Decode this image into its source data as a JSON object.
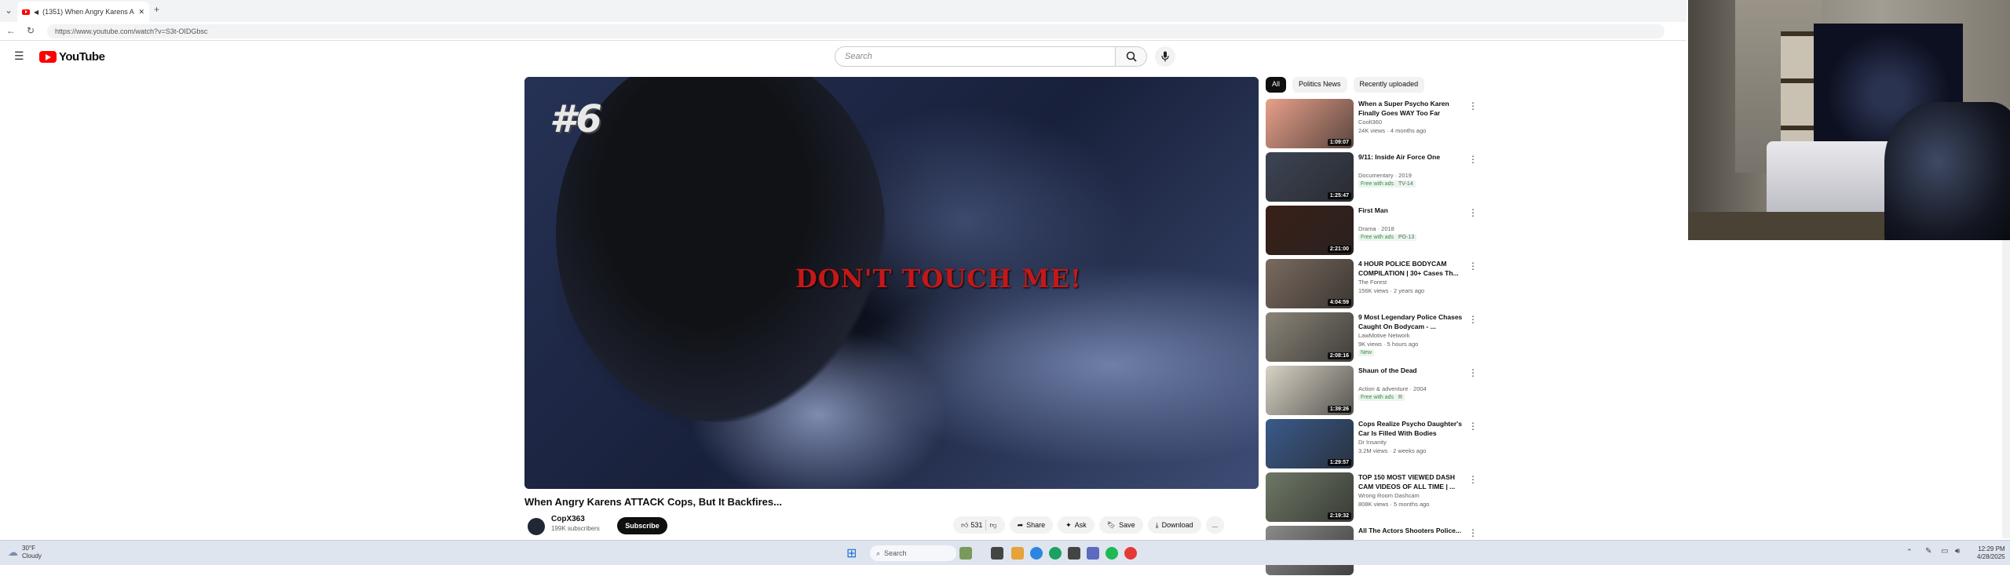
{
  "browser": {
    "tab_title": "(1351) When Angry Karens A",
    "new_tab": "+",
    "url": "https://www.youtube.com/watch?v=S3t-OIDGbsc"
  },
  "header": {
    "logo_text": "YouTube",
    "search_placeholder": "Search"
  },
  "video": {
    "rank_overlay": "#6",
    "caption_overlay": "DON'T TOUCH ME!",
    "title": "When Angry Karens ATTACK Cops, But It Backfires...",
    "channel": "CopX363",
    "subscribers": "199K subscribers",
    "subscribe_label": "Subscribe",
    "likes": "531",
    "share_label": "Share",
    "ask_label": "Ask",
    "save_label": "Save",
    "download_label": "Download",
    "more_label": "..."
  },
  "chips": [
    "All",
    "Politics News",
    "Recently uploaded"
  ],
  "recommendations": [
    {
      "title": "When a Super Psycho Karen Finally Goes WAY Too Far",
      "channel": "Coolt360",
      "meta": "24K views · 4 months ago",
      "duration": "1:09:07",
      "badge": "",
      "rating": "",
      "thumb": "#e8a08a"
    },
    {
      "title": "9/11: Inside Air Force One",
      "channel": "Documentary · 2019",
      "meta": "",
      "duration": "1:25:47",
      "badge": "Free with ads",
      "rating": "TV-14",
      "thumb": "#3c4454"
    },
    {
      "title": "First Man",
      "channel": "Drama · 2018",
      "meta": "",
      "duration": "2:21:00",
      "badge": "Free with ads",
      "rating": "PG-13",
      "thumb": "#3a2018"
    },
    {
      "title": "4 HOUR POLICE BODYCAM COMPILATION | 30+ Cases Th...",
      "channel": "The Forest",
      "meta": "156K views · 2 years ago",
      "duration": "4:04:59",
      "badge": "",
      "rating": "",
      "thumb": "#7a6a5e"
    },
    {
      "title": "9 Most Legendary Police Chases Caught On Bodycam - ...",
      "channel": "LawMotive Network",
      "meta": "9K views · 5 hours ago",
      "duration": "2:08:16",
      "badge": "New",
      "rating": "",
      "thumb": "#8a8478"
    },
    {
      "title": "Shaun of the Dead",
      "channel": "Action & adventure · 2004",
      "meta": "",
      "duration": "1:39:26",
      "badge": "Free with ads",
      "rating": "R",
      "thumb": "#d8d2c4"
    },
    {
      "title": "Cops Realize Psycho Daughter's Car Is Filled With Bodies",
      "channel": "Dr Insanity",
      "meta": "3.2M views · 2 weeks ago",
      "duration": "1:29:57",
      "badge": "",
      "rating": "",
      "thumb": "#3a5a8a"
    },
    {
      "title": "TOP 150 MOST VIEWED DASH CAM VIDEOS OF ALL TIME | ...",
      "channel": "Wrong Room Dashcam",
      "meta": "808K views · 5 months ago",
      "duration": "2:19:32",
      "badge": "",
      "rating": "",
      "thumb": "#6e7866"
    },
    {
      "title": "All The Actors Shooters Police...",
      "channel": "",
      "meta": "",
      "duration": "",
      "badge": "",
      "rating": "",
      "thumb": "#8a8a8a"
    }
  ],
  "taskbar": {
    "weather_temp": "30°F",
    "weather_desc": "Cloudy",
    "search_label": "Search",
    "time": "12:29 PM",
    "date": "4/28/2025"
  }
}
